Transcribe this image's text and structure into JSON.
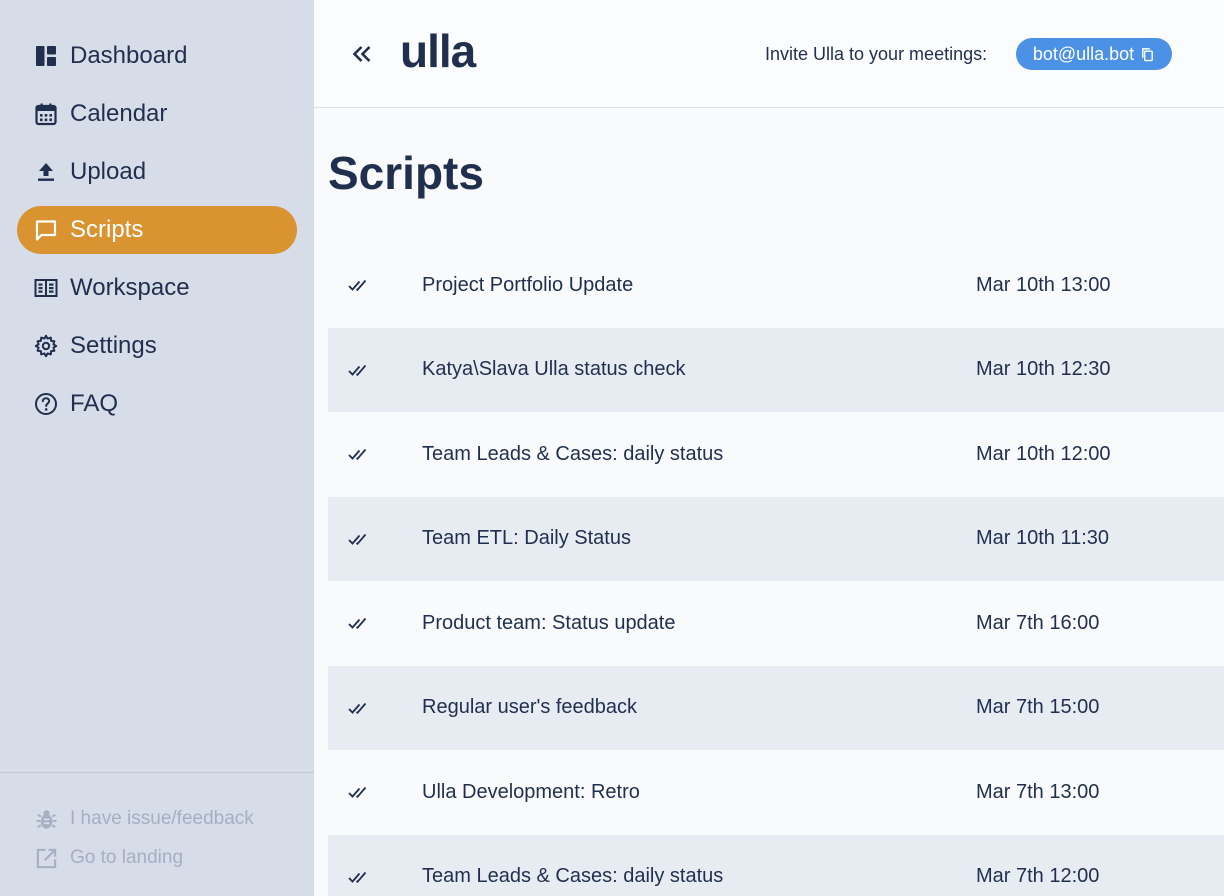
{
  "sidebar": {
    "items": [
      {
        "label": "Dashboard",
        "icon": "dashboard-icon"
      },
      {
        "label": "Calendar",
        "icon": "calendar-icon"
      },
      {
        "label": "Upload",
        "icon": "upload-icon"
      },
      {
        "label": "Scripts",
        "icon": "chat-icon",
        "active": true
      },
      {
        "label": "Workspace",
        "icon": "workspace-icon"
      },
      {
        "label": "Settings",
        "icon": "gear-icon"
      },
      {
        "label": "FAQ",
        "icon": "help-icon"
      }
    ],
    "footer": {
      "feedback_label": "I have issue/feedback",
      "landing_label": "Go to landing"
    }
  },
  "header": {
    "logo": "ulla",
    "invite_label": "Invite Ulla to your meetings:",
    "email": "bot@ulla.bot"
  },
  "main": {
    "title": "Scripts",
    "rows": [
      {
        "title": "Project Portfolio Update",
        "time": "Mar 10th 13:00"
      },
      {
        "title": "Katya\\Slava Ulla status check",
        "time": "Mar 10th 12:30"
      },
      {
        "title": "Team Leads & Cases: daily status",
        "time": "Mar 10th 12:00"
      },
      {
        "title": "Team ETL: Daily Status",
        "time": "Mar 10th 11:30"
      },
      {
        "title": "Product team: Status update",
        "time": "Mar 7th 16:00"
      },
      {
        "title": "Regular user's feedback",
        "time": "Mar 7th 15:00"
      },
      {
        "title": "Ulla Development: Retro",
        "time": "Mar 7th 13:00"
      },
      {
        "title": "Team Leads & Cases: daily status",
        "time": "Mar 7th 12:00"
      }
    ]
  },
  "colors": {
    "sidebar_bg": "#d7dde8",
    "accent": "#d99330",
    "email_badge": "#4b91e6",
    "text": "#1f2f4d",
    "row_alt": "#e7ebf2"
  }
}
